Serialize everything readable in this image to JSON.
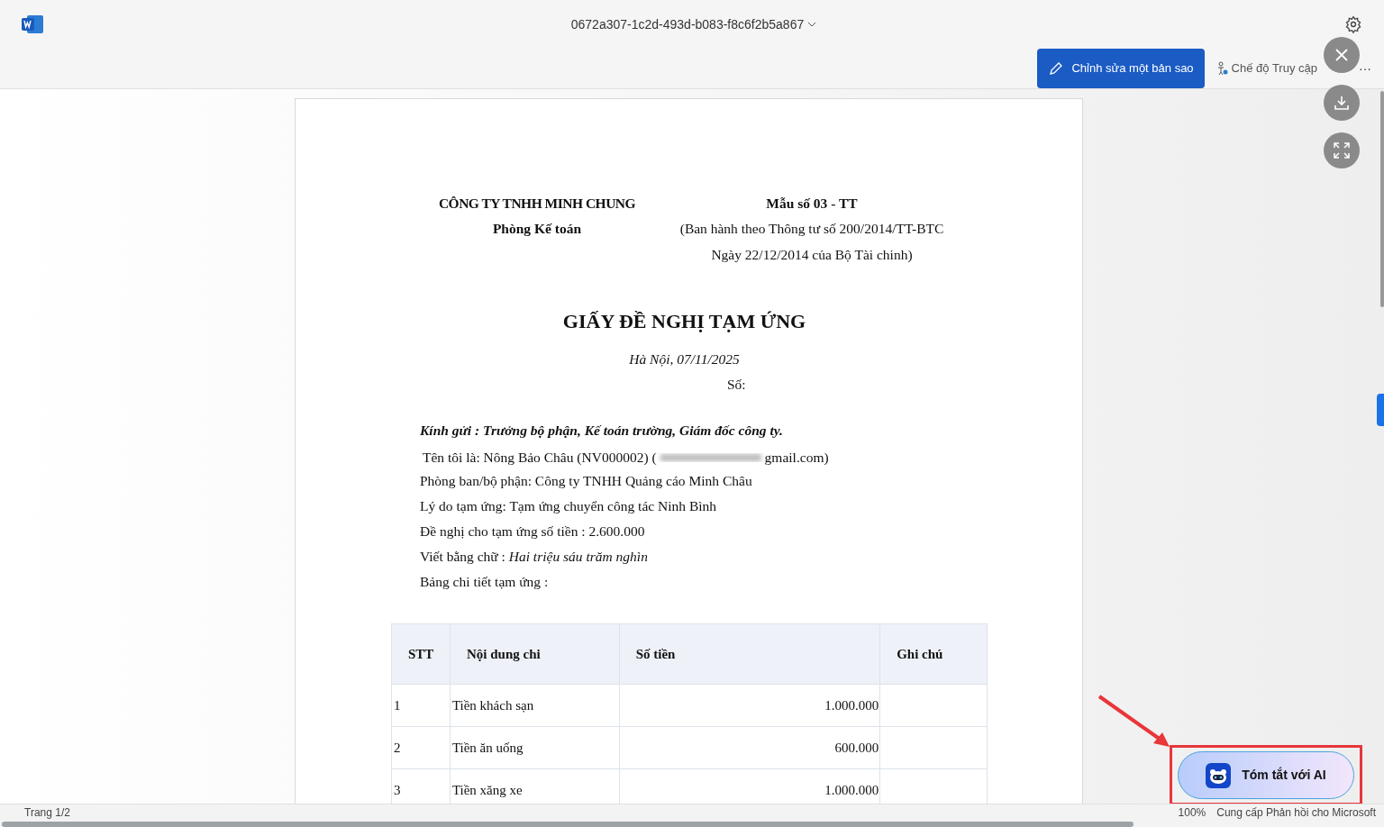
{
  "header": {
    "file_name": "0672a307-1c2d-493d-b083-f8c6f2b5a867",
    "edit_button": "Chỉnh sửa một bản sao",
    "access_mode": "Chế độ Truy cập",
    "more": "···"
  },
  "document": {
    "company": "CÔNG TY TNHH MINH CHUNG",
    "department": "Phòng Kế toán",
    "form_no": "Mẫu số 03 - TT",
    "form_note_1": "(Ban hành theo Thông tư số 200/2014/TT-BTC",
    "form_note_2": "Ngày 22/12/2014 của Bộ Tài chinh)",
    "title": "GIẤY ĐỀ NGHỊ TẠM ỨNG",
    "place_date": "Hà Nội, 07/11/2025",
    "number_label": "Số:",
    "greeting": "Kính gửi : Trưởng bộ phận, Kế toán trường, Giám đốc công ty.",
    "name_line_start": "Tên tôi là: Nông Bảo Châu (NV000002) (",
    "name_line_end": "gmail.com)",
    "lines": [
      "Phòng ban/bộ phận: Công ty TNHH Quảng cáo Minh Châu",
      "Lý do tạm ứng: Tạm ứng chuyển công tác Ninh Bình",
      "Đề nghị cho tạm ứng số tiền : 2.600.000",
      "Viết bằng chữ : *Hai triệu sáu trăm nghìn*",
      "Bảng chi tiết tạm ứng :"
    ],
    "table": {
      "columns": [
        "STT",
        "Nội dung chi",
        "Số tiền",
        "Ghi chú"
      ],
      "rows": [
        [
          "1",
          "Tiền khách sạn",
          "1.000.000",
          ""
        ],
        [
          "2",
          "Tiền ăn uống",
          "600.000",
          ""
        ],
        [
          "3",
          "Tiền xăng xe",
          "1.000.000",
          ""
        ]
      ]
    }
  },
  "ai_button": "Tóm tắt với AI",
  "status_bar": {
    "page": "Trang 1/2",
    "zoom": "100%",
    "feedback": "Cung cấp Phản hồi cho Microsoft"
  }
}
